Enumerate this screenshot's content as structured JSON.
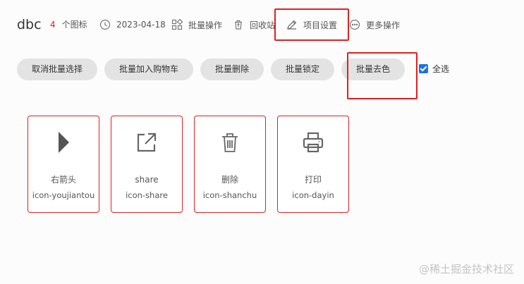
{
  "header": {
    "project_name": "dbc",
    "icon_count": "4",
    "icon_count_unit": "个图标",
    "date": "2023-04-18",
    "batch_ops": "批量操作",
    "recycle_bin": "回收站",
    "project_settings": "项目设置",
    "more_ops": "更多操作"
  },
  "batch_bar": {
    "cancel_batch": "取消批量选择",
    "add_to_cart": "批量加入购物车",
    "delete": "批量删除",
    "lock": "批量锁定",
    "decolor": "批量去色",
    "select_all": "全选",
    "select_all_checked": true
  },
  "icons": [
    {
      "name": "右箭头",
      "code": "icon-youjiantou",
      "glyph": "arrow-right-icon"
    },
    {
      "name": "share",
      "code": "icon-share",
      "glyph": "share-icon"
    },
    {
      "name": "删除",
      "code": "icon-shanchu",
      "glyph": "trash-icon"
    },
    {
      "name": "打印",
      "code": "icon-dayin",
      "glyph": "printer-icon"
    }
  ],
  "watermark": "@稀土掘金技术社区",
  "colors": {
    "accent_red": "#e02020",
    "checkbox_blue": "#1a73e8",
    "button_gray": "#e3e3e3"
  }
}
